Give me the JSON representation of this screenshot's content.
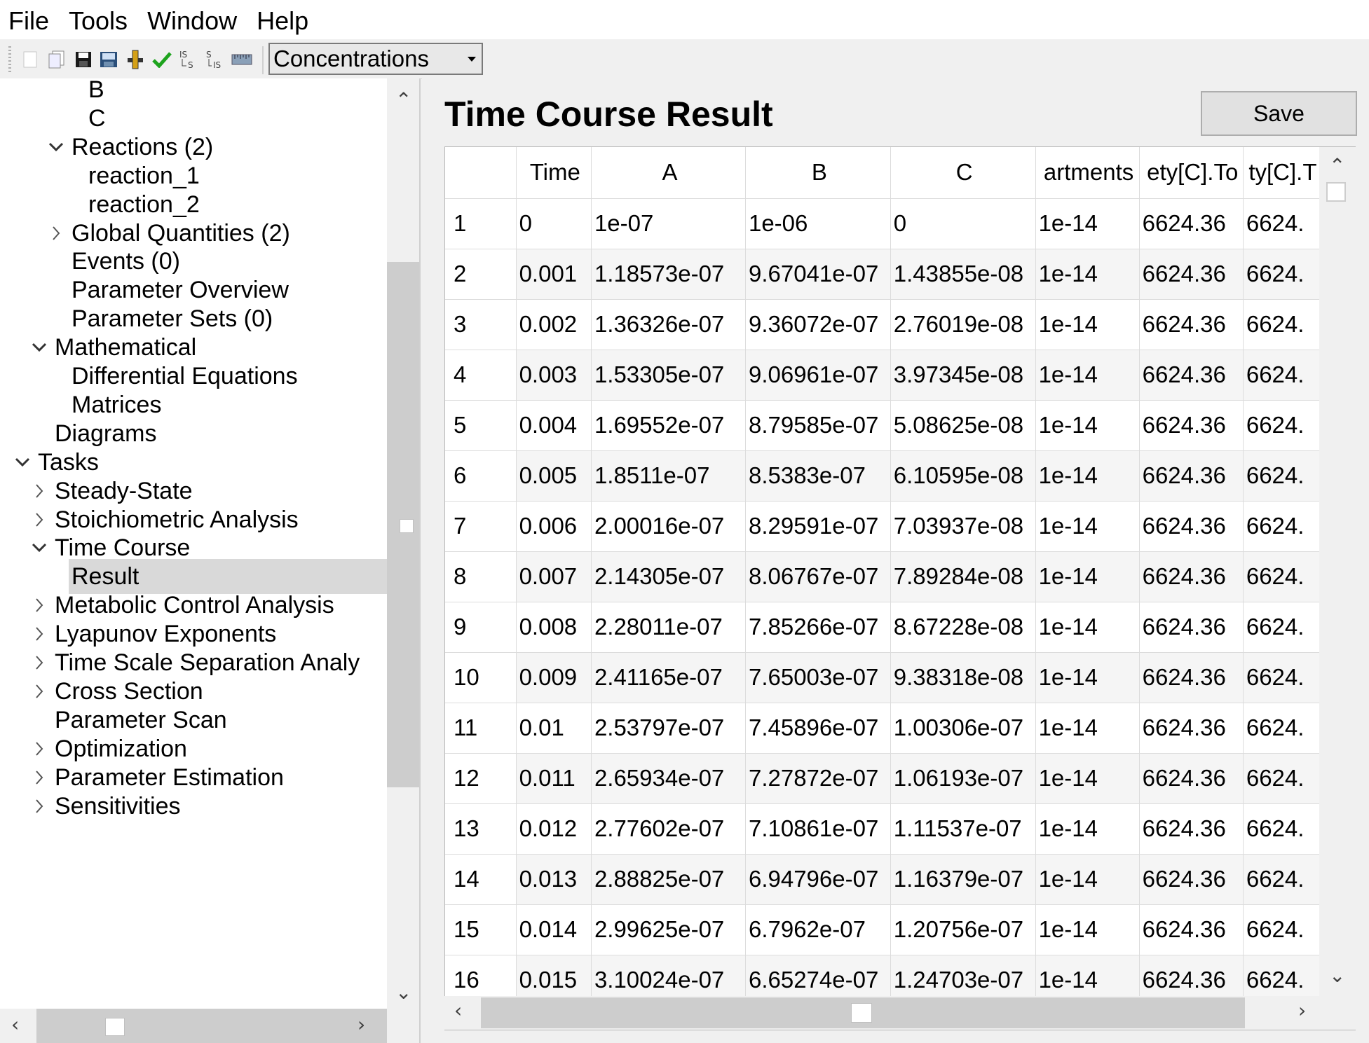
{
  "menu": [
    "File",
    "Tools",
    "Window",
    "Help"
  ],
  "toolbar": {
    "icons": [
      "new-icon",
      "open-icon",
      "save-icon",
      "save-as-icon",
      "slider-icon",
      "check-icon",
      "convert-is-icon",
      "convert-si-icon",
      "ruler-icon"
    ],
    "combo_value": "Concentrations"
  },
  "tree": [
    {
      "label": "B",
      "depth": 4,
      "expander": "none"
    },
    {
      "label": "C",
      "depth": 4,
      "expander": "none"
    },
    {
      "label": "Reactions (2)",
      "depth": 3,
      "expander": "open"
    },
    {
      "label": "reaction_1",
      "depth": 4,
      "expander": "none"
    },
    {
      "label": "reaction_2",
      "depth": 4,
      "expander": "none"
    },
    {
      "label": "Global Quantities (2)",
      "depth": 3,
      "expander": "closed"
    },
    {
      "label": "Events (0)",
      "depth": 3,
      "expander": "none"
    },
    {
      "label": "Parameter Overview",
      "depth": 3,
      "expander": "none"
    },
    {
      "label": "Parameter Sets (0)",
      "depth": 3,
      "expander": "none"
    },
    {
      "label": "Mathematical",
      "depth": 2,
      "expander": "open"
    },
    {
      "label": "Differential Equations",
      "depth": 3,
      "expander": "none"
    },
    {
      "label": "Matrices",
      "depth": 3,
      "expander": "none"
    },
    {
      "label": "Diagrams",
      "depth": 2,
      "expander": "none"
    },
    {
      "label": "Tasks",
      "depth": 1,
      "expander": "open"
    },
    {
      "label": "Steady-State",
      "depth": 2,
      "expander": "closed"
    },
    {
      "label": "Stoichiometric Analysis",
      "depth": 2,
      "expander": "closed"
    },
    {
      "label": "Time Course",
      "depth": 2,
      "expander": "open"
    },
    {
      "label": "Result",
      "depth": 3,
      "expander": "none",
      "selected": true
    },
    {
      "label": "Metabolic Control Analysis",
      "depth": 2,
      "expander": "closed"
    },
    {
      "label": "Lyapunov Exponents",
      "depth": 2,
      "expander": "closed"
    },
    {
      "label": "Time Scale Separation Analy",
      "depth": 2,
      "expander": "closed"
    },
    {
      "label": "Cross Section",
      "depth": 2,
      "expander": "closed"
    },
    {
      "label": "Parameter Scan",
      "depth": 2,
      "expander": "none"
    },
    {
      "label": "Optimization",
      "depth": 2,
      "expander": "closed"
    },
    {
      "label": "Parameter Estimation",
      "depth": 2,
      "expander": "closed"
    },
    {
      "label": "Sensitivities",
      "depth": 2,
      "expander": "closed"
    }
  ],
  "main": {
    "title": "Time Course Result",
    "save_label": "Save"
  },
  "table": {
    "columns": [
      "",
      "Time",
      "A",
      "B",
      "C",
      "artments",
      "ety[C].To",
      "ty[C].T"
    ],
    "rows": [
      [
        "1",
        "0",
        "1e-07",
        "1e-06",
        "0",
        "1e-14",
        "6624.36",
        "6624."
      ],
      [
        "2",
        "0.001",
        "1.18573e-07",
        "9.67041e-07",
        "1.43855e-08",
        "1e-14",
        "6624.36",
        "6624."
      ],
      [
        "3",
        "0.002",
        "1.36326e-07",
        "9.36072e-07",
        "2.76019e-08",
        "1e-14",
        "6624.36",
        "6624."
      ],
      [
        "4",
        "0.003",
        "1.53305e-07",
        "9.06961e-07",
        "3.97345e-08",
        "1e-14",
        "6624.36",
        "6624."
      ],
      [
        "5",
        "0.004",
        "1.69552e-07",
        "8.79585e-07",
        "5.08625e-08",
        "1e-14",
        "6624.36",
        "6624."
      ],
      [
        "6",
        "0.005",
        "1.8511e-07",
        "8.5383e-07",
        "6.10595e-08",
        "1e-14",
        "6624.36",
        "6624."
      ],
      [
        "7",
        "0.006",
        "2.00016e-07",
        "8.29591e-07",
        "7.03937e-08",
        "1e-14",
        "6624.36",
        "6624."
      ],
      [
        "8",
        "0.007",
        "2.14305e-07",
        "8.06767e-07",
        "7.89284e-08",
        "1e-14",
        "6624.36",
        "6624."
      ],
      [
        "9",
        "0.008",
        "2.28011e-07",
        "7.85266e-07",
        "8.67228e-08",
        "1e-14",
        "6624.36",
        "6624."
      ],
      [
        "10",
        "0.009",
        "2.41165e-07",
        "7.65003e-07",
        "9.38318e-08",
        "1e-14",
        "6624.36",
        "6624."
      ],
      [
        "11",
        "0.01",
        "2.53797e-07",
        "7.45896e-07",
        "1.00306e-07",
        "1e-14",
        "6624.36",
        "6624."
      ],
      [
        "12",
        "0.011",
        "2.65934e-07",
        "7.27872e-07",
        "1.06193e-07",
        "1e-14",
        "6624.36",
        "6624."
      ],
      [
        "13",
        "0.012",
        "2.77602e-07",
        "7.10861e-07",
        "1.11537e-07",
        "1e-14",
        "6624.36",
        "6624."
      ],
      [
        "14",
        "0.013",
        "2.88825e-07",
        "6.94796e-07",
        "1.16379e-07",
        "1e-14",
        "6624.36",
        "6624."
      ],
      [
        "15",
        "0.014",
        "2.99625e-07",
        "6.7962e-07",
        "1.20756e-07",
        "1e-14",
        "6624.36",
        "6624."
      ],
      [
        "16",
        "0.015",
        "3.10024e-07",
        "6.65274e-07",
        "1.24703e-07",
        "1e-14",
        "6624.36",
        "6624."
      ]
    ]
  }
}
